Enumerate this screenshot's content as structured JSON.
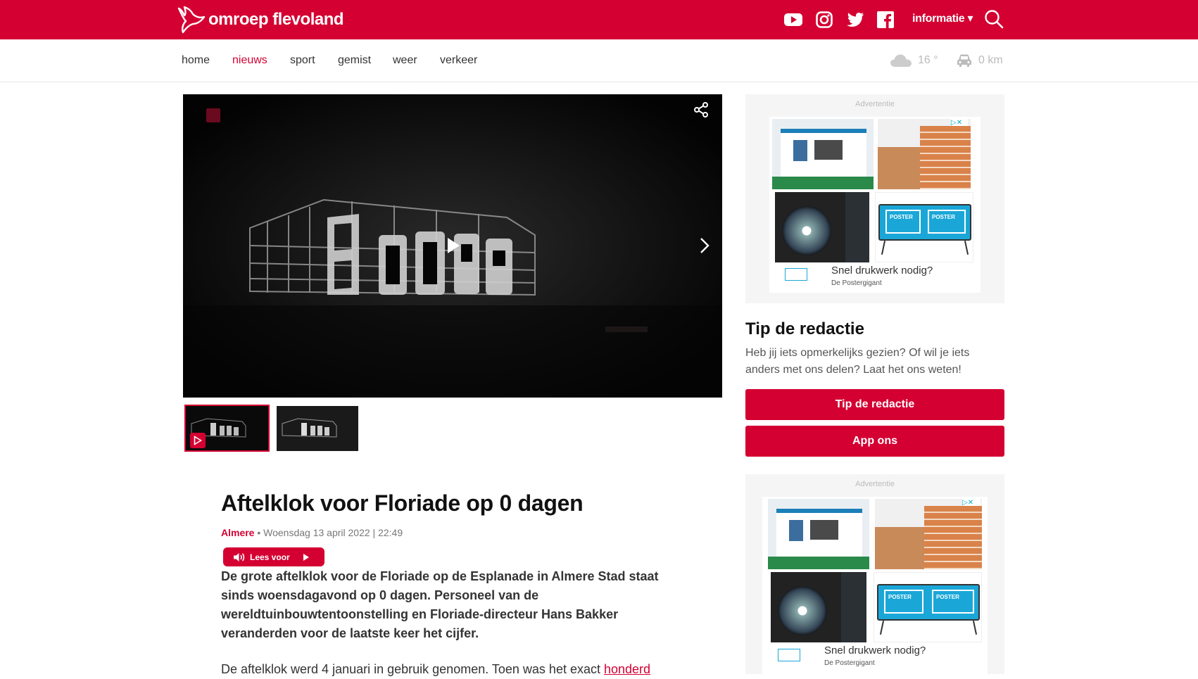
{
  "header": {
    "logo_text": "omroep flevoland",
    "info_menu": "informatie ▾",
    "social": [
      "youtube-icon",
      "instagram-icon",
      "twitter-icon",
      "facebook-icon"
    ],
    "brand_color": "#d40032"
  },
  "nav": {
    "items": [
      {
        "label": "home",
        "active": false
      },
      {
        "label": "nieuws",
        "active": true
      },
      {
        "label": "sport",
        "active": false
      },
      {
        "label": "gemist",
        "active": false
      },
      {
        "label": "weer",
        "active": false
      },
      {
        "label": "verkeer",
        "active": false
      }
    ],
    "temperature": "16 °",
    "traffic": "0 km"
  },
  "video": {
    "thumbnails": [
      "video-thumbnail-1",
      "video-thumbnail-2"
    ]
  },
  "article": {
    "title": "Aftelklok voor Floriade op 0 dagen",
    "location": "Almere",
    "date": " • Woensdag 13 april 2022 | 22:49",
    "read_aloud": "Lees voor",
    "lead": "De grote aftelklok voor de Floriade op de Esplanade in Almere Stad staat sinds woensdagavond op 0 dagen. Personeel van de wereldtuinbouwtentoonstelling en Floriade-directeur Hans Bakker veranderden voor de laatste keer het cijfer.",
    "body_start": "De aftelklok werd 4 januari in gebruik genomen. Toen was het exact ",
    "body_link": "honderd"
  },
  "sidebar": {
    "ad_label": "Advertentie",
    "ad_caption": "Snel drukwerk nodig?",
    "ad_sponsor": "De Postergigant",
    "ad_poster_text": "POSTER",
    "tip_title": "Tip de redactie",
    "tip_text": "Heb jij iets opmerkelijks gezien? Of wil je iets anders met ons delen? Laat het ons weten!",
    "tip_button": "Tip de redactie",
    "app_button": "App ons"
  }
}
